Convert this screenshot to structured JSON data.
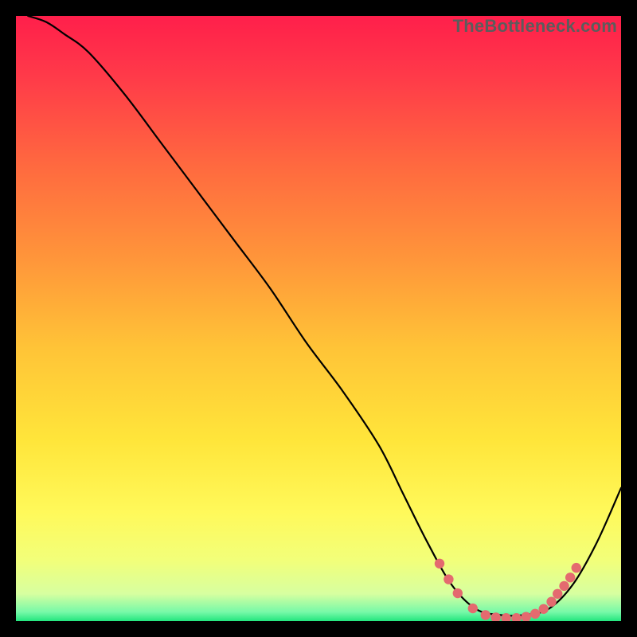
{
  "watermark": "TheBottleneck.com",
  "chart_data": {
    "type": "line",
    "title": "",
    "xlabel": "",
    "ylabel": "",
    "xlim": [
      0,
      100
    ],
    "ylim": [
      0,
      100
    ],
    "grid": false,
    "legend": false,
    "gradient_stops": [
      {
        "offset": 0.0,
        "color": "#ff1f4b"
      },
      {
        "offset": 0.1,
        "color": "#ff3a49"
      },
      {
        "offset": 0.25,
        "color": "#ff6a3f"
      },
      {
        "offset": 0.4,
        "color": "#ff953a"
      },
      {
        "offset": 0.55,
        "color": "#ffc437"
      },
      {
        "offset": 0.7,
        "color": "#ffe53a"
      },
      {
        "offset": 0.82,
        "color": "#fff95a"
      },
      {
        "offset": 0.9,
        "color": "#f2ff7a"
      },
      {
        "offset": 0.955,
        "color": "#d7ffa0"
      },
      {
        "offset": 0.985,
        "color": "#77f9a8"
      },
      {
        "offset": 1.0,
        "color": "#22e67e"
      }
    ],
    "series": [
      {
        "name": "bottleneck-curve",
        "color": "#000000",
        "x": [
          2,
          5,
          8,
          12,
          18,
          24,
          30,
          36,
          42,
          48,
          54,
          60,
          64,
          68,
          72,
          76,
          80,
          84,
          88,
          92,
          96,
          100
        ],
        "values": [
          100,
          99,
          97,
          94,
          87,
          79,
          71,
          63,
          55,
          46,
          38,
          29,
          21,
          13,
          6,
          2,
          1,
          1,
          2,
          6,
          13,
          22
        ]
      }
    ],
    "markers": {
      "name": "optimal-range-markers",
      "color": "#e46a6f",
      "x": [
        70.0,
        71.5,
        73.0,
        75.5,
        77.6,
        79.3,
        81.0,
        82.7,
        84.3,
        85.8,
        87.2,
        88.5,
        89.5,
        90.6,
        91.6,
        92.6
      ],
      "values": [
        9.5,
        6.9,
        4.6,
        2.1,
        1.0,
        0.6,
        0.5,
        0.5,
        0.7,
        1.2,
        2.0,
        3.2,
        4.5,
        5.8,
        7.2,
        8.8
      ]
    }
  }
}
